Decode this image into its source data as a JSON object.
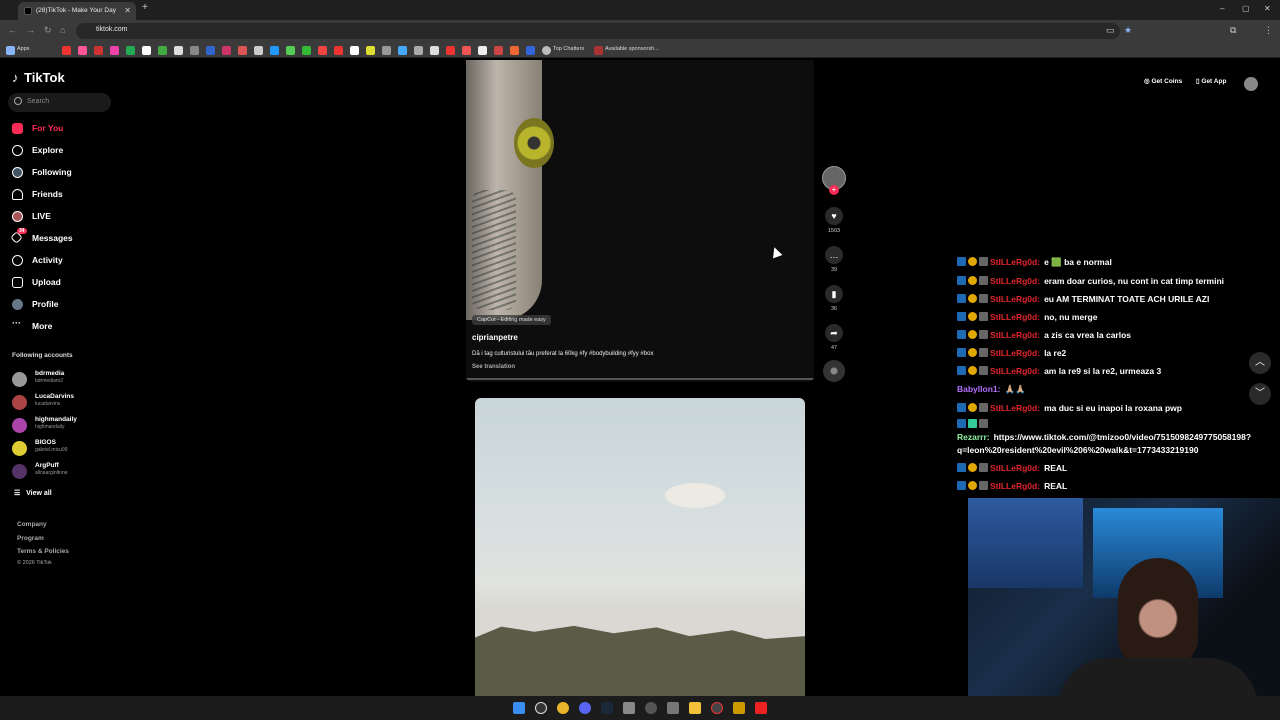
{
  "browser": {
    "tab_title": "(28)TikTok - Make Your Day",
    "url": "tiktok.com",
    "bookmarks": {
      "apps": "Apps",
      "top_chatters": "Top Chatters",
      "available_sponsors": "Available sponsorsh..."
    }
  },
  "sidebar": {
    "logo": "TikTok",
    "search_placeholder": "Search",
    "items": [
      {
        "label": "For You",
        "icon": "home-icon",
        "active": true
      },
      {
        "label": "Explore",
        "icon": "compass-icon"
      },
      {
        "label": "Following",
        "icon": "following-icon"
      },
      {
        "label": "Friends",
        "icon": "friends-icon"
      },
      {
        "label": "LIVE",
        "icon": "live-icon"
      },
      {
        "label": "Messages",
        "icon": "messages-icon",
        "badge": "34"
      },
      {
        "label": "Activity",
        "icon": "activity-icon"
      },
      {
        "label": "Upload",
        "icon": "upload-icon"
      },
      {
        "label": "Profile",
        "icon": "profile-icon"
      },
      {
        "label": "More",
        "icon": "more-icon"
      }
    ],
    "following_title": "Following accounts",
    "accounts": [
      {
        "name": "bdrmedia",
        "handle": "bdrmediaro2"
      },
      {
        "name": "LucaDarvins",
        "handle": "lucadarvins"
      },
      {
        "name": "highmandaily",
        "handle": "highmandaily"
      },
      {
        "name": "BIGOS",
        "handle": "gabriel.micu99"
      },
      {
        "name": "ArgPuff",
        "handle": "allnaarginltone"
      }
    ],
    "view_all": "View all",
    "footer": [
      "Company",
      "Program",
      "Terms & Policies",
      "© 2026 TikTok"
    ]
  },
  "header": {
    "get_coins": "Get Coins",
    "get_app": "Get App"
  },
  "video1": {
    "watermark": "CapCut - Editing made easy",
    "author": "ciprianpetre",
    "description": "Dă i tag culturistului tău preferat la 60kg #fy #bodybuilding #fyy #box",
    "see_translation": "See translation",
    "likes": "1503",
    "comments": "39",
    "saves": "36",
    "shares": "47"
  },
  "chat": [
    {
      "user": "StILLeRg0d:",
      "msg": "e 🟩 ba e normal"
    },
    {
      "user": "StILLeRg0d:",
      "msg": "eram doar curios, nu cont in cat timp termini"
    },
    {
      "user": "StILLeRg0d:",
      "msg": "eu AM TERMINAT TOATE ACH URILE AZI"
    },
    {
      "user": "StILLeRg0d:",
      "msg": "no, nu merge"
    },
    {
      "user": "StILLeRg0d:",
      "msg": "a zis ca vrea la carlos"
    },
    {
      "user": "StILLeRg0d:",
      "msg": "la re2"
    },
    {
      "user": "StILLeRg0d:",
      "msg": "am la re9 si la re2, urmeaza 3"
    },
    {
      "user": "Babyllon1:",
      "msg": "🙏🏼🙏🏼"
    },
    {
      "user": "StILLeRg0d:",
      "msg": "ma duc si eu inapoi la roxana pwp"
    },
    {
      "user": "Rezarrr:",
      "msg": "https://www.tiktok.com/@tmizoo0/video/7515098249775058198?"
    },
    {
      "user": "",
      "msg": "q=leon%20resident%20evil%206%20walk&t=1773433219190"
    },
    {
      "user": "StILLeRg0d:",
      "msg": "REAL"
    },
    {
      "user": "StILLeRg0d:",
      "msg": "REAL"
    }
  ],
  "colors": {
    "accent": "#fe2c55",
    "chat_user": "#e0252b",
    "background": "#000000"
  }
}
